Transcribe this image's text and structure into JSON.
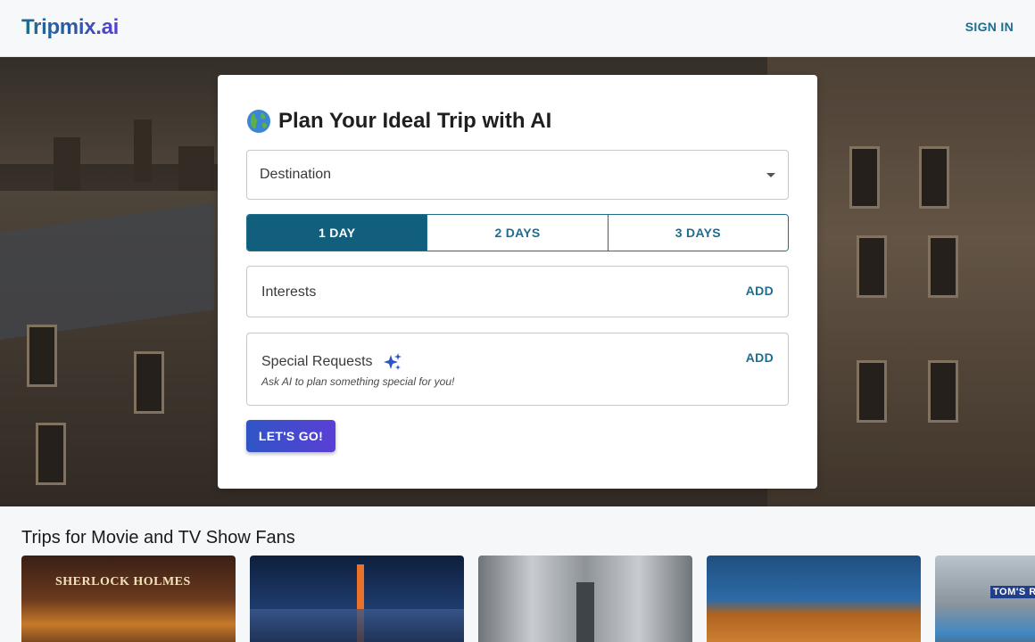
{
  "header": {
    "logo_text": "Tripmix.ai",
    "signin_label": "SIGN IN"
  },
  "planner": {
    "title": "Plan Your Ideal Trip with AI",
    "title_icon": "globe-icon",
    "destination_label": "Destination",
    "days": [
      {
        "label": "1 DAY",
        "selected": true
      },
      {
        "label": "2 DAYS",
        "selected": false
      },
      {
        "label": "3 DAYS",
        "selected": false
      }
    ],
    "interests_label": "Interests",
    "interests_add_label": "ADD",
    "special_label": "Special Requests",
    "special_icon": "sparkle-icon",
    "special_hint": "Ask AI to plan something special for you!",
    "special_add_label": "ADD",
    "submit_label": "LET'S GO!"
  },
  "colors": {
    "primary": "#115f7d",
    "accent_start": "#2f55c5",
    "accent_end": "#5a3fd6"
  },
  "section": {
    "title": "Trips for Movie and TV Show Fans",
    "tiles": [
      {
        "subject": "Sherlock Holmes pub",
        "sign_text": "SHERLOCK HOLMES"
      },
      {
        "subject": "Tokyo tower at night"
      },
      {
        "subject": "Bridge colonnade in Paris"
      },
      {
        "subject": "Colosseum in Rome"
      },
      {
        "subject": "Street scene with restaurant",
        "sign_text": "TOM'S RESTA"
      }
    ]
  }
}
